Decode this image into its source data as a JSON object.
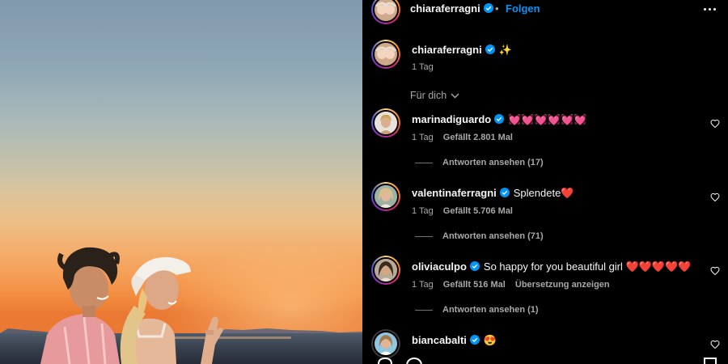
{
  "post": {
    "author": "chiaraferragni",
    "follow_label": "Folgen",
    "separator": "•",
    "caption_author": "chiaraferragni",
    "caption_text": "✨",
    "caption_time": "1 Tag"
  },
  "sort_label": "Für dich",
  "comments": [
    {
      "username": "marinadiguardo",
      "text": "💓💓💓💓💓💓",
      "time": "1 Tag",
      "likes": "Gefällt 2.801 Mal",
      "translate": "",
      "replies": "Antworten ansehen (17)"
    },
    {
      "username": "valentinaferragni",
      "text": "Splendete❤️",
      "time": "1 Tag",
      "likes": "Gefällt 5.706 Mal",
      "translate": "",
      "replies": "Antworten ansehen (71)"
    },
    {
      "username": "oliviaculpo",
      "text": "So happy for you beautiful girl ❤️❤️❤️❤️❤️",
      "time": "1 Tag",
      "likes": "Gefällt 516 Mal",
      "translate": "Übersetzung anzeigen",
      "replies": "Antworten ansehen (1)"
    },
    {
      "username": "biancabalti",
      "text": "😍",
      "time": "",
      "likes": "",
      "translate": "",
      "replies": ""
    }
  ],
  "colors": {
    "accent": "#0095f6",
    "verified": "#0095f6",
    "background": "#000000",
    "muted_text": "#a8a8a8"
  },
  "icons": {
    "verified": "verified-badge-icon",
    "more": "more-horizontal-icon",
    "like": "heart-outline-icon",
    "sort": "chevron-down-icon"
  }
}
